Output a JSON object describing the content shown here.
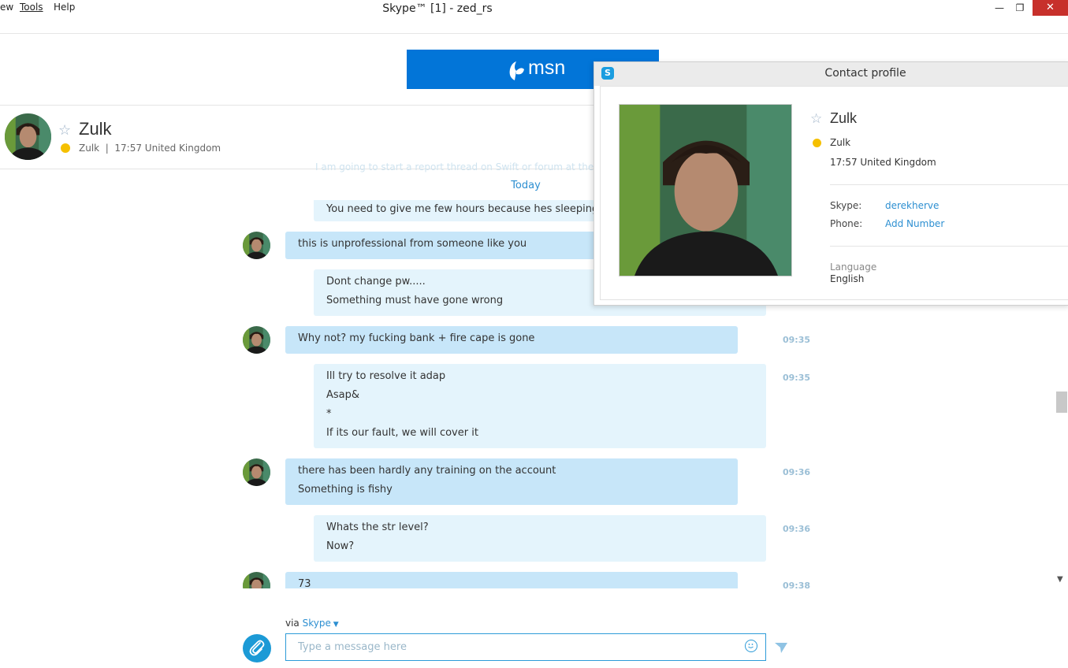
{
  "window": {
    "title": "Skype™ [1] - zed_rs",
    "minimize_glyph": "—",
    "maximize_glyph": "❐",
    "close_glyph": "✕"
  },
  "menu": [
    "ew",
    "Tools",
    "Help"
  ],
  "ad": {
    "brand": "msn"
  },
  "header": {
    "name": "Zulk",
    "status": "Zulk  |  17:57 United Kingdom"
  },
  "chat": {
    "faded_line": "I am going to start a report thread on Swift or forum at the",
    "day_divider": "Today",
    "messages": [
      {
        "dir": "out",
        "lines": [
          "You need to give me few hours because hes sleeping atm"
        ],
        "time": ""
      },
      {
        "dir": "in",
        "lines": [
          "this is unprofessional from someone like you"
        ],
        "time": ""
      },
      {
        "dir": "out",
        "lines": [
          "Dont change pw.....",
          "Something must have gone wrong"
        ],
        "time": ""
      },
      {
        "dir": "in",
        "lines": [
          "Why not? my fucking bank + fire cape is gone"
        ],
        "time": "09:35"
      },
      {
        "dir": "out",
        "lines": [
          "Ill try to resolve it adap",
          "Asap&",
          "*",
          "If its our fault, we will cover it"
        ],
        "time": "09:35"
      },
      {
        "dir": "in",
        "lines": [
          "there has been hardly any training on the account",
          "Something is fishy"
        ],
        "time": "09:36"
      },
      {
        "dir": "out",
        "lines": [
          "Whats the str level?",
          "Now?"
        ],
        "time": "09:36"
      },
      {
        "dir": "in",
        "lines": [
          "73"
        ],
        "time": "09:38"
      }
    ]
  },
  "compose": {
    "via_label": "via",
    "via_service": "Skype",
    "placeholder": "Type a message here"
  },
  "profile": {
    "window_title": "Contact profile",
    "name": "Zulk",
    "status_line": "Zulk",
    "location": "17:57 United Kingdom",
    "skype_label": "Skype:",
    "skype_value": "derekherve",
    "phone_label": "Phone:",
    "phone_value": "Add Number",
    "language_label": "Language",
    "language_value": "English"
  },
  "colors": {
    "accent": "#2d8fd1",
    "incoming_bubble": "#c7e6f9",
    "outgoing_bubble": "#e4f4fc",
    "msn_blue": "#0275d8",
    "presence_away": "#f5c000"
  }
}
